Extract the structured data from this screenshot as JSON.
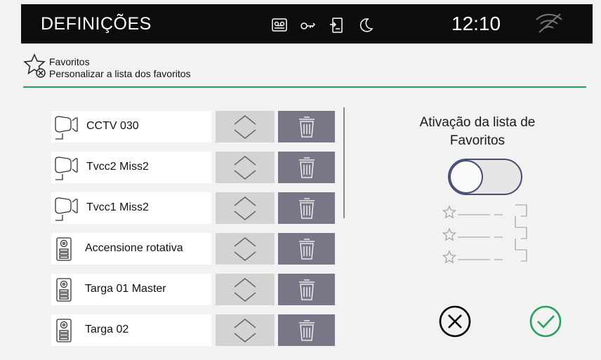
{
  "header_bar": {
    "title": "DEFINIÇÕES",
    "time": "12:10",
    "status_icons": [
      "voicemail-icon",
      "key-icon",
      "door-phone-icon",
      "moon-icon",
      "wifi-off-icon"
    ]
  },
  "section": {
    "icon": "star-remove-icon",
    "title": "Favoritos",
    "subtitle": "Personalizar a lista dos favoritos"
  },
  "favorites": [
    {
      "label": "CCTV 030",
      "icon": "camera-icon"
    },
    {
      "label": "Tvcc2 Miss2",
      "icon": "camera-icon"
    },
    {
      "label": "Tvcc1 Miss2",
      "icon": "camera-icon"
    },
    {
      "label": "Accensione rotativa",
      "icon": "entrance-panel-icon"
    },
    {
      "label": "Targa 01 Master",
      "icon": "entrance-panel-icon"
    },
    {
      "label": "Targa 02",
      "icon": "entrance-panel-icon"
    }
  ],
  "panel": {
    "activation_label": "Ativação da lista de Favoritos",
    "toggle_on": false
  },
  "colors": {
    "accent_green": "#27a060",
    "delete_bg": "#777788",
    "move_bg": "#d3d3d3",
    "toggle_border": "#454d70"
  }
}
